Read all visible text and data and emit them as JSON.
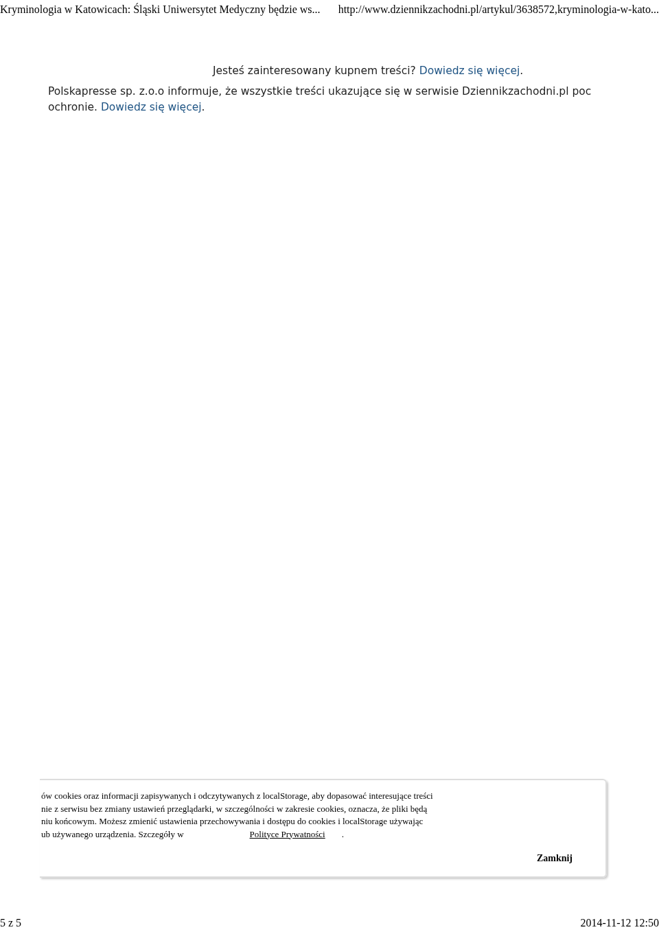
{
  "print_header": {
    "title": "Kryminologia w Katowicach: Śląski Uniwersytet Medyczny będzie ws...",
    "url": "http://www.dziennikzachodni.pl/artykul/3638572,kryminologia-w-kato..."
  },
  "purchase_notice": {
    "text": "Jesteś zainteresowany kupnem treści?",
    "link": "Dowiedz się więcej",
    "end": "."
  },
  "copyright_notice": {
    "text": "Polskapresse sp. z.o.o informuje, że wszystkie treści ukazujące się w serwisie Dziennikzachodni.pl poc",
    "text_2": "ochronie.",
    "link": "Dowiedz się więcej",
    "end": "."
  },
  "cookie_banner": {
    "lines": [
      "ów cookies oraz informacji zapisywanych i odczytywanych z localStorage, aby dopasować interesujące treści",
      "nie z serwisu bez zmiany ustawień przeglądarki, w szczególności w zakresie cookies, oznacza, że pliki będą",
      "niu końcowym. Możesz zmienić ustawienia przechowywania i dostępu do cookies i localStorage używając",
      "ub używanego urządzenia. Szczegóły w"
    ],
    "link": "Polityce Prywatności",
    "end": ".",
    "button": "Zamknij"
  },
  "print_footer": {
    "page": "5 z 5",
    "datetime": "2014-11-12 12:50"
  }
}
